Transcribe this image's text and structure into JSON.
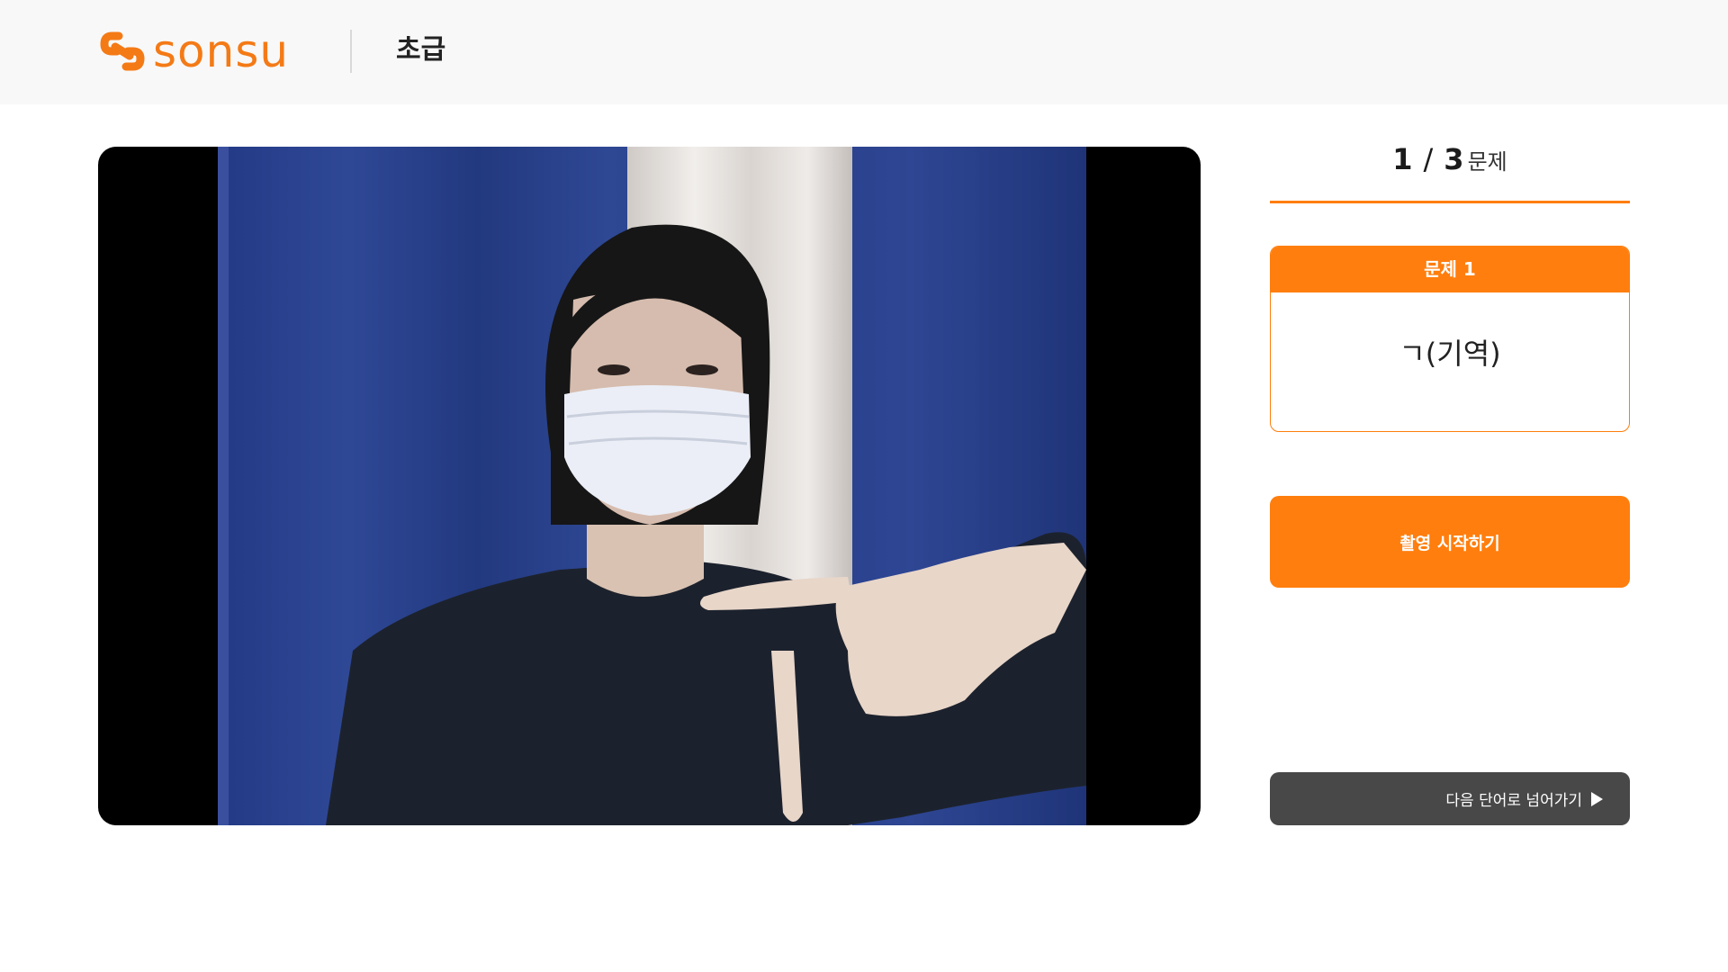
{
  "header": {
    "logo_text": "sonsu",
    "level_label": "초급"
  },
  "progress": {
    "current": "1",
    "separator": "/",
    "total": "3",
    "unit": "문제"
  },
  "question": {
    "title": "문제 1",
    "word": "ㄱ(기역)"
  },
  "actions": {
    "start_label": "촬영 시작하기",
    "next_label": "다음 단어로 넘어가기"
  },
  "colors": {
    "accent": "#ff7e0d",
    "brand": "#f47a16",
    "next_button": "#484848",
    "header_bg": "#f8f8f8"
  },
  "icons": {
    "logo": "sonsu-link-logo-icon",
    "next": "play-triangle-icon"
  }
}
